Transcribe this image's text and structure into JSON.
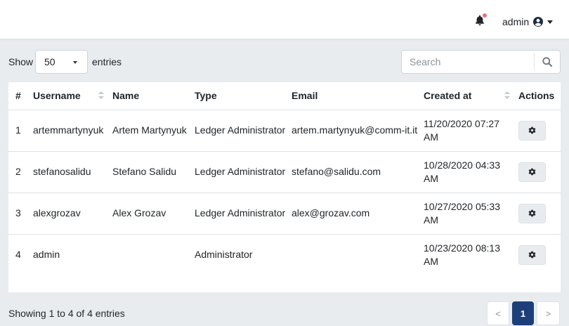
{
  "header": {
    "user_label": "admin",
    "notification_dot_color": "#f06b7e"
  },
  "controls": {
    "show_label": "Show",
    "page_size": "50",
    "entries_label": "entries",
    "search_placeholder": "Search"
  },
  "table": {
    "columns": [
      "#",
      "Username",
      "Name",
      "Type",
      "Email",
      "Created at",
      "Actions"
    ],
    "sortable_columns": [
      "Username",
      "Created at"
    ],
    "rows": [
      {
        "num": "1",
        "username": "artemmartynyuk",
        "name": "Artem Martynyuk",
        "type": "Ledger Administrator",
        "email": "artem.martynyuk@comm-it.it",
        "created": "11/20/2020 07:27 AM"
      },
      {
        "num": "2",
        "username": "stefanosalidu",
        "name": "Stefano Salidu",
        "type": "Ledger Administrator",
        "email": "stefano@salidu.com",
        "created": "10/28/2020 04:33 AM"
      },
      {
        "num": "3",
        "username": "alexgrozav",
        "name": "Alex Grozav",
        "type": "Ledger Administrator",
        "email": "alex@grozav.com",
        "created": "10/27/2020 05:33 AM"
      },
      {
        "num": "4",
        "username": "admin",
        "name": "",
        "type": "Administrator",
        "email": "",
        "created": "10/23/2020 08:13 AM"
      }
    ]
  },
  "footer": {
    "info": "Showing 1 to 4 of 4 entries",
    "prev": "<",
    "current_page": "1",
    "next": ">"
  },
  "colors": {
    "accent": "#1c3f7a",
    "background": "#e9ecef"
  }
}
